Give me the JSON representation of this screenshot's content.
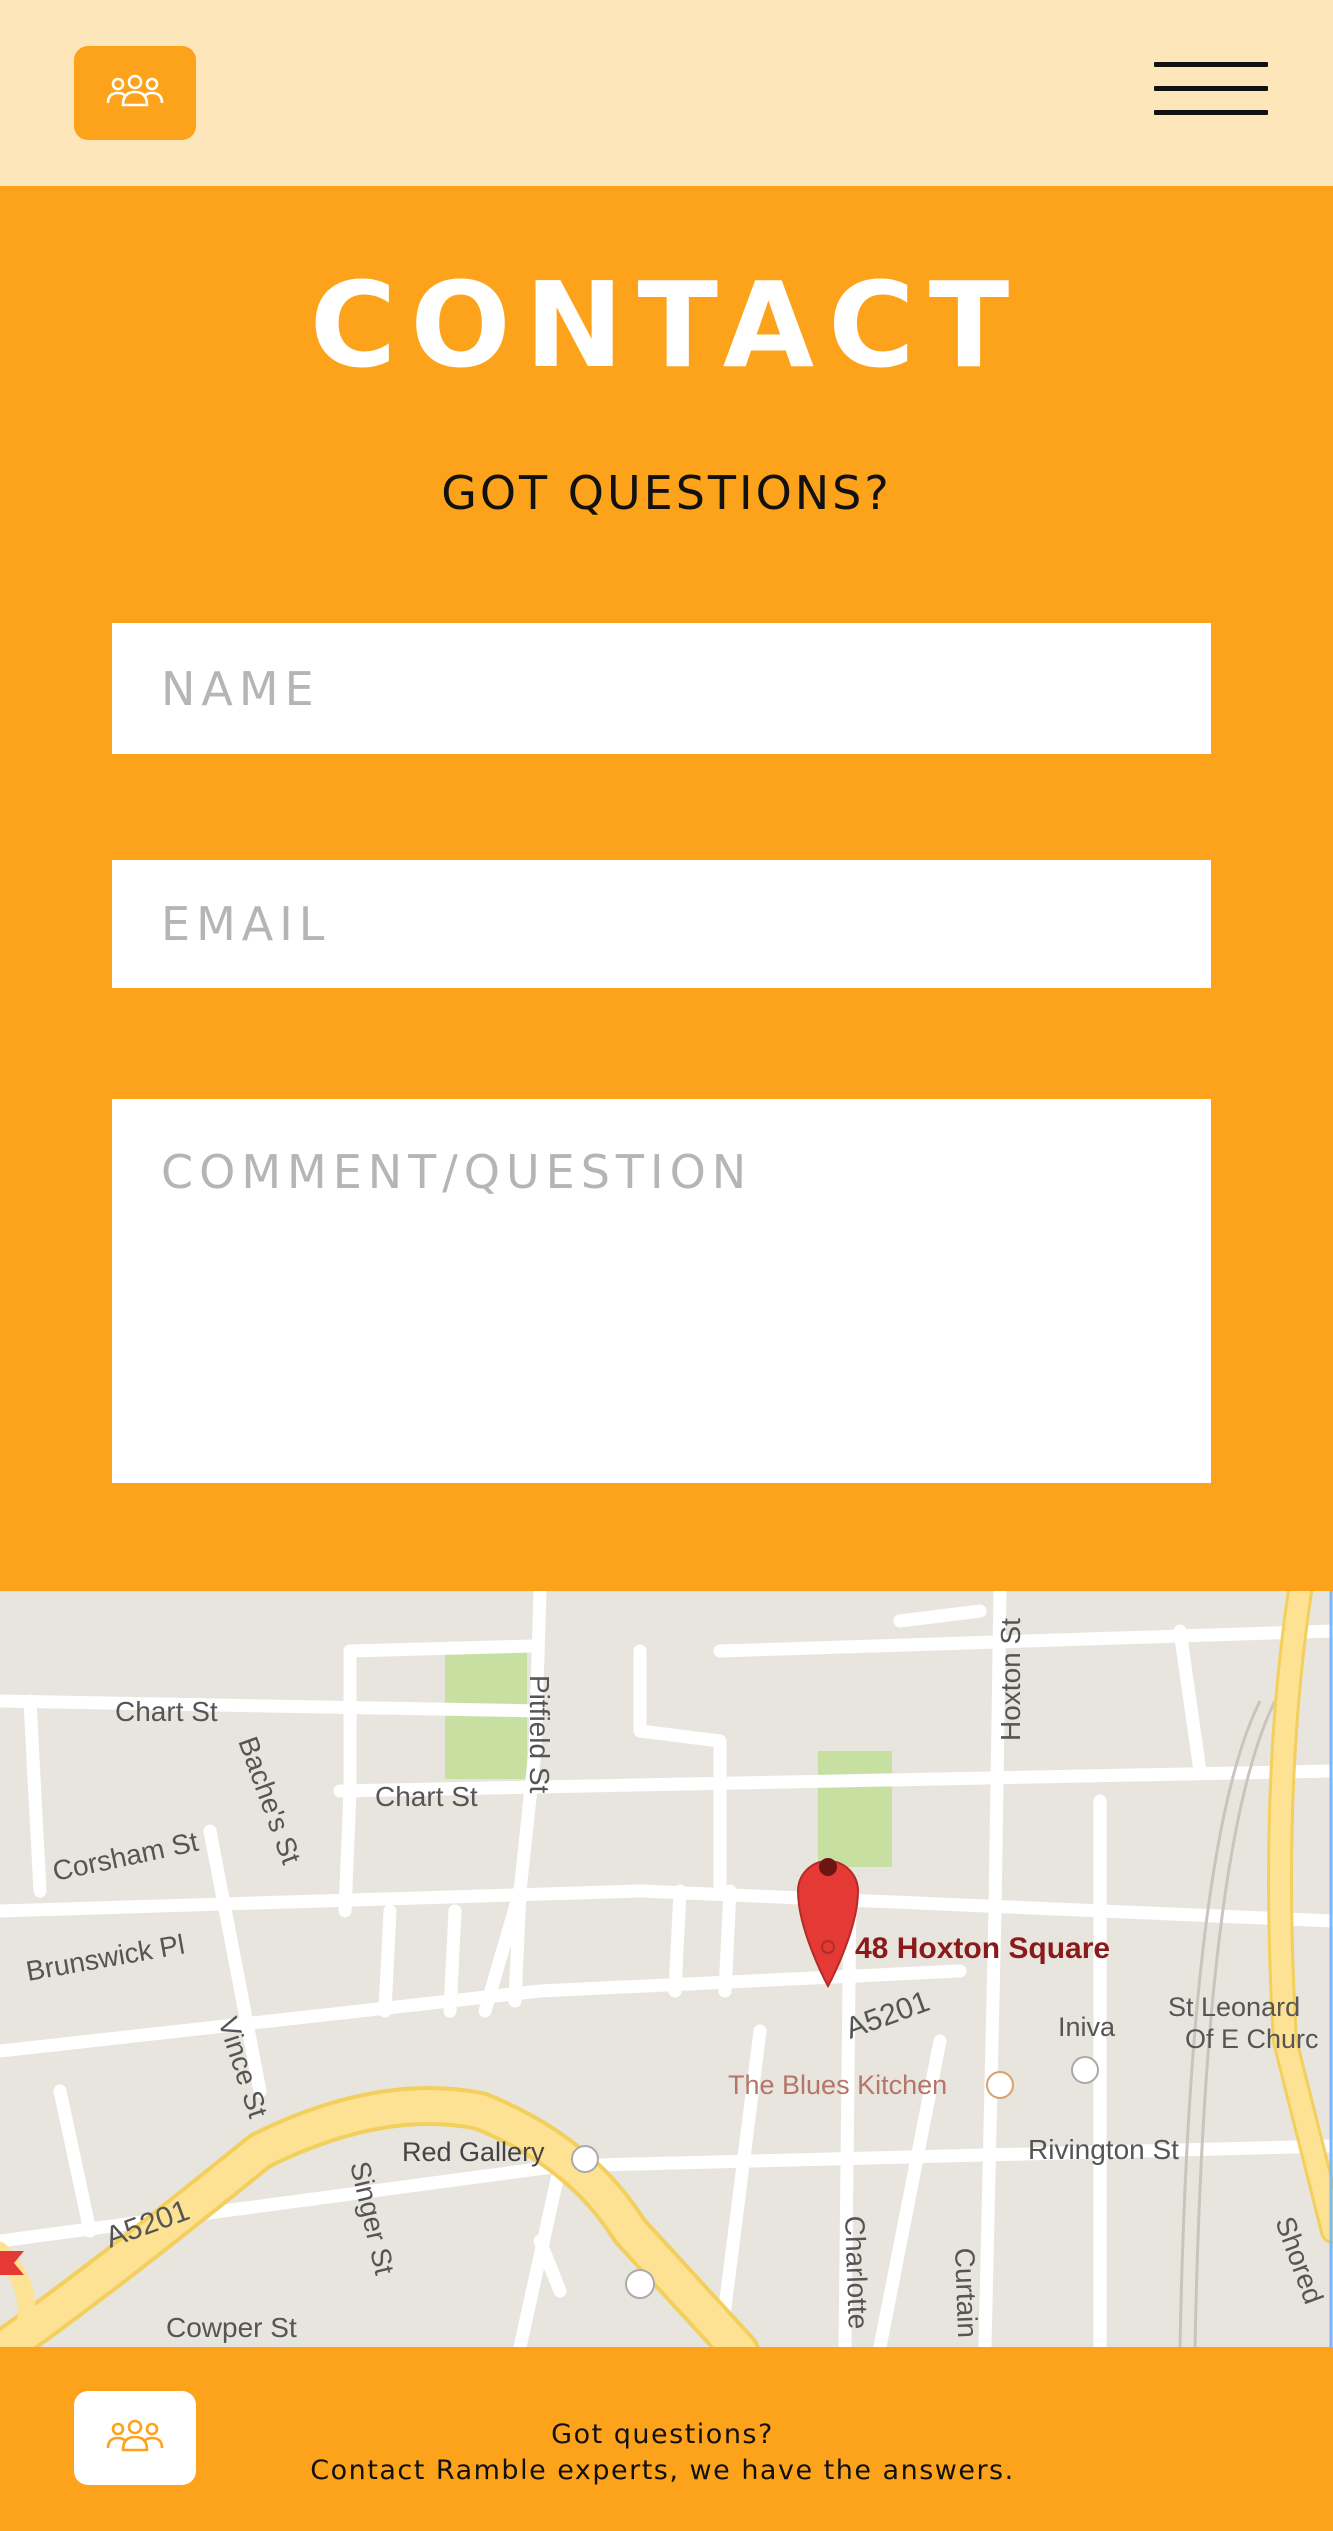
{
  "header": {
    "logo_icon": "people-group-icon",
    "menu_icon": "hamburger-menu-icon"
  },
  "contact": {
    "title": "CONTACT",
    "subtitle": "GOT QUESTIONS?",
    "name_placeholder": "NAME",
    "email_placeholder": "EMAIL",
    "comment_placeholder": "COMMENT/QUESTION"
  },
  "map": {
    "marker_label": "48 Hoxton Square",
    "places": [
      "The Blues Kitchen",
      "Iniva",
      "St Leonard",
      "Of E Churc",
      "Red Gallery"
    ],
    "streets": [
      "Chart St",
      "Chart St",
      "Pitfield St",
      "Hoxton St",
      "Bache's St",
      "Corsham St",
      "Brunswick Pl",
      "A5201",
      "A5201",
      "Vince St",
      "Singer St",
      "Rivington St",
      "Cowper St",
      "Charlotte",
      "Curtain",
      "Shored"
    ],
    "colors": {
      "land": "#e8e5de",
      "road": "#ffffff",
      "major_road": "#fde293",
      "park": "#c7e0a2",
      "marker": "#e53935",
      "label": "#8b1a1a"
    }
  },
  "footer": {
    "logo_icon": "people-group-icon",
    "line1": "Got questions?",
    "line2": "Contact Ramble experts, we have the answers."
  },
  "colors": {
    "accent": "#fca31b",
    "header_bg": "#fde6b9"
  }
}
